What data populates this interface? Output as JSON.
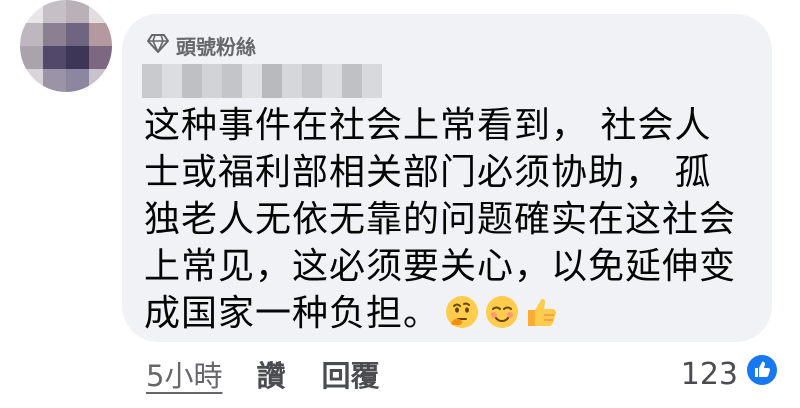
{
  "comment": {
    "badge_label": "頭號粉絲",
    "lines": [
      "这种事件在社会上常看到， 社会人",
      "士或福利部相关部门必须协助， 孤",
      "独老人无依无靠的问题確实在这社会",
      "上常见，这必须要关心，以免延伸变",
      "成国家一种负担。"
    ],
    "emojis": [
      "thinking-face-emoji",
      "smiling-face-emoji",
      "thumbs-up-emoji"
    ]
  },
  "footer": {
    "time": "5小時",
    "like_label": "讚",
    "reply_label": "回覆",
    "reaction_count": "123",
    "reaction_icon": "like-icon"
  },
  "colors": {
    "bubble": "#f0f2f5",
    "secondary_text": "#65676b",
    "like_blue": "#1877f2"
  }
}
